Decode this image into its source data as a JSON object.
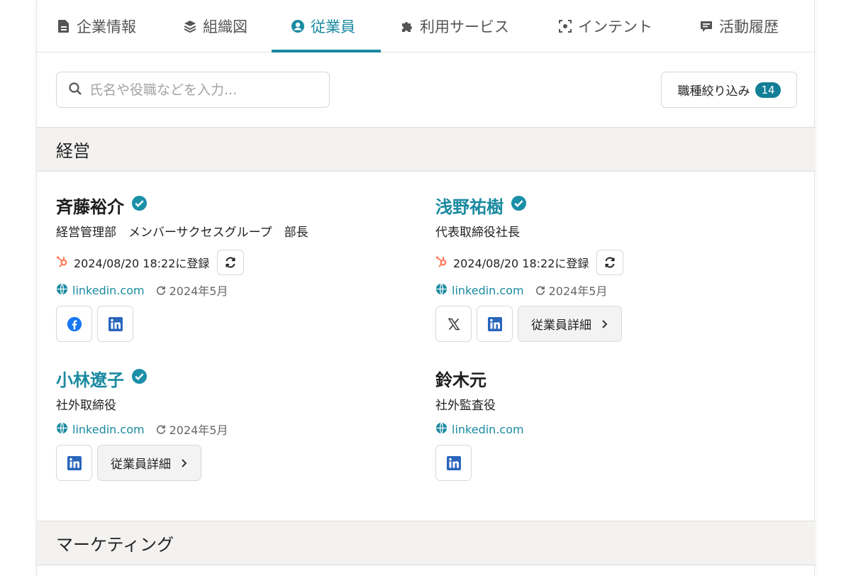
{
  "tabs": [
    {
      "label": "企業情報",
      "icon": "document-icon"
    },
    {
      "label": "組織図",
      "icon": "layers-icon"
    },
    {
      "label": "従業員",
      "icon": "user-circle-icon",
      "active": true
    },
    {
      "label": "利用サービス",
      "icon": "puzzle-icon"
    },
    {
      "label": "インテント",
      "icon": "focus-icon"
    },
    {
      "label": "活動履歴",
      "icon": "comment-icon"
    }
  ],
  "search": {
    "placeholder": "氏名や役職などを入力..."
  },
  "filter": {
    "label": "職種絞り込み",
    "count": "14"
  },
  "sections": [
    {
      "title": "経営"
    },
    {
      "title": "マーケティング"
    }
  ],
  "people": [
    {
      "name": "斉藤裕介",
      "role": "経営管理部　メンバーサクセスグループ　部長",
      "registered": "2024/08/20 18:22に登録",
      "link": "linkedin.com",
      "date": "2024年5月"
    },
    {
      "name": "浅野祐樹",
      "role": "代表取締役社長",
      "registered": "2024/08/20 18:22に登録",
      "link": "linkedin.com",
      "date": "2024年5月",
      "detail_label": "従業員詳細"
    },
    {
      "name": "小林遼子",
      "role": "社外取締役",
      "link": "linkedin.com",
      "date": "2024年5月",
      "detail_label": "従業員詳細"
    },
    {
      "name": "鈴木元",
      "role": "社外監査役",
      "link": "linkedin.com"
    }
  ],
  "colors": {
    "accent": "#1a8aa0",
    "hubspot": "#ff7a59",
    "verified": "#1b8fa8",
    "facebook": "#1877f2",
    "linkedin": "#2a66bc"
  }
}
